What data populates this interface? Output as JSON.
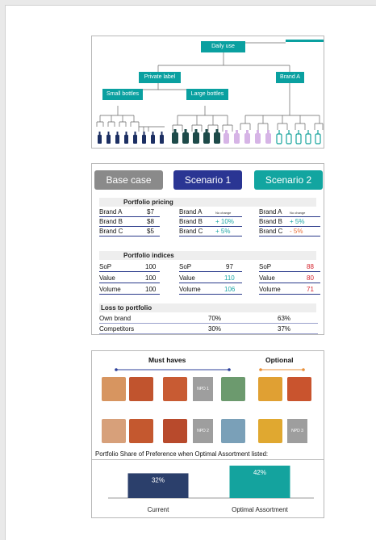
{
  "tree": {
    "root": "Daily use",
    "level2": [
      "Private label",
      "Brand A"
    ],
    "level3": [
      "Small bottles",
      "Large bottles"
    ]
  },
  "scenario_table": {
    "headers": [
      "Base case",
      "Scenario 1",
      "Scenario 2"
    ],
    "header_colors": [
      "#8a8a8a",
      "#2a3593",
      "#12a5a0"
    ],
    "pricing_title": "Portfolio pricing",
    "pricing": {
      "base": [
        [
          "Brand A",
          "$7"
        ],
        [
          "Brand B",
          "$8"
        ],
        [
          "Brand C",
          "$5"
        ]
      ],
      "s1": [
        [
          "Brand A",
          "No change"
        ],
        [
          "Brand B",
          "+ 10%"
        ],
        [
          "Brand C",
          "+ 5%"
        ]
      ],
      "s2": [
        [
          "Brand A",
          "No change"
        ],
        [
          "Brand B",
          "+ 5%"
        ],
        [
          "Brand C",
          "- 5%"
        ]
      ]
    },
    "indices_title": "Portfolio indices",
    "indices": {
      "base": [
        [
          "SoP",
          "100"
        ],
        [
          "Value",
          "100"
        ],
        [
          "Volume",
          "100"
        ]
      ],
      "s1": [
        [
          "SoP",
          "97"
        ],
        [
          "Value",
          "110"
        ],
        [
          "Volume",
          "106"
        ]
      ],
      "s2": [
        [
          "SoP",
          "88"
        ],
        [
          "Value",
          "80"
        ],
        [
          "Volume",
          "71"
        ]
      ]
    },
    "loss_title": "Loss to portfolio",
    "loss": [
      [
        "Own brand",
        "70%",
        "63%"
      ],
      [
        "Competitors",
        "30%",
        "37%"
      ]
    ]
  },
  "assortment": {
    "must_haves": "Must haves",
    "optional": "Optional",
    "npd_labels": [
      "NPD 1",
      "NPD 2",
      "NPD 3"
    ],
    "caption": "Portfolio Share of Preference when Optimal Assortment listed:",
    "chart_data": {
      "type": "bar",
      "categories": [
        "Current",
        "Optimal Assortment"
      ],
      "values": [
        32,
        42
      ],
      "data_labels": [
        "32%",
        "42%"
      ],
      "colors": [
        "#2b3f6b",
        "#14a39e"
      ],
      "ylim": [
        0,
        46
      ]
    }
  }
}
